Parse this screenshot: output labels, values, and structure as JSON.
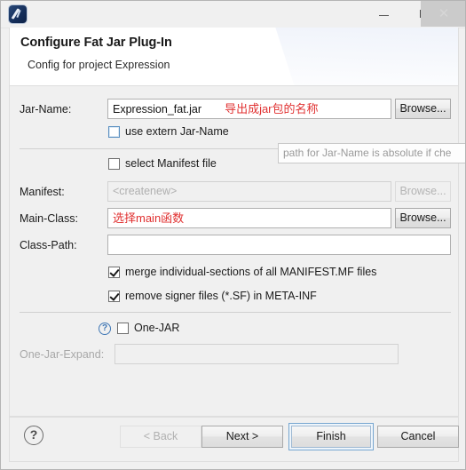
{
  "window": {
    "icon_name": "fat-jar-plugin-icon",
    "controls": {
      "minimize": "—",
      "maximize": "❐",
      "close": "✕"
    }
  },
  "header": {
    "title": "Configure Fat Jar Plug-In",
    "subtitle": "Config for project Expression"
  },
  "form": {
    "jar_name": {
      "label": "Jar-Name:",
      "value": "Expression_fat.jar",
      "annotation": "导出成jar包的名称",
      "browse_label": "Browse..."
    },
    "use_extern": {
      "label": "use extern Jar-Name",
      "checked": false
    },
    "select_manifest": {
      "label": "select Manifest file",
      "checked": false
    },
    "manifest": {
      "label": "Manifest:",
      "value": "<createnew>",
      "browse_label": "Browse..."
    },
    "main_class": {
      "label": "Main-Class:",
      "value": "",
      "annotation": "选择main函数",
      "browse_label": "Browse..."
    },
    "class_path": {
      "label": "Class-Path:",
      "value": ""
    },
    "merge_sections": {
      "label": "merge individual-sections of all MANIFEST.MF files",
      "checked": true
    },
    "remove_signer": {
      "label": "remove signer files (*.SF) in META-INF",
      "checked": true
    },
    "one_jar": {
      "label": "One-JAR",
      "checked": false,
      "help_glyph": "?"
    },
    "one_jar_expand": {
      "label": "One-Jar-Expand:",
      "value": ""
    }
  },
  "tooltip": {
    "text": "path for Jar-Name is absolute if che"
  },
  "footer": {
    "help_glyph": "?",
    "back_label": "< Back",
    "next_label": "Next >",
    "finish_label": "Finish",
    "cancel_label": "Cancel"
  },
  "colors": {
    "annotation_red": "#e03030",
    "focus_blue": "#76a6d0",
    "window_bg": "#f0f0f0"
  }
}
